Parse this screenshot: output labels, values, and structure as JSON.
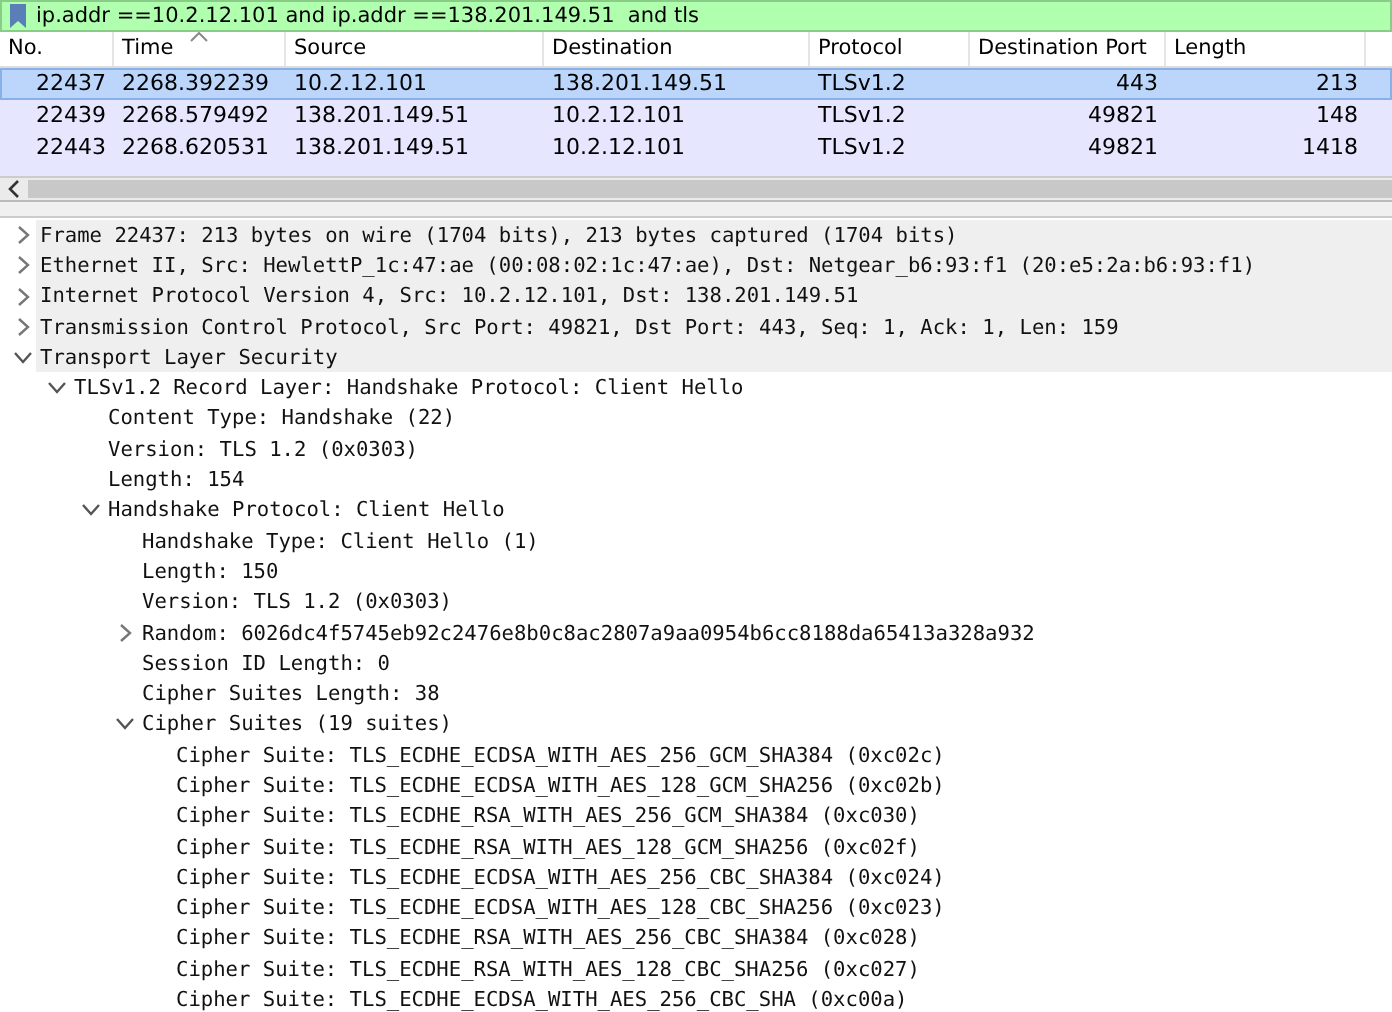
{
  "filter": {
    "value": "ip.addr ==10.2.12.101 and ip.addr ==138.201.149.51  and tls"
  },
  "packet_list": {
    "columns": [
      {
        "label": "No.",
        "sorted": false
      },
      {
        "label": "Time",
        "sorted": true
      },
      {
        "label": "Source",
        "sorted": false
      },
      {
        "label": "Destination",
        "sorted": false
      },
      {
        "label": "Protocol",
        "sorted": false
      },
      {
        "label": "Destination Port",
        "sorted": false
      },
      {
        "label": "Length",
        "sorted": false
      }
    ],
    "rows": [
      {
        "selected": true,
        "cells": [
          "22437",
          "2268.392239",
          "10.2.12.101",
          "138.201.149.51",
          "TLSv1.2",
          "443",
          "213"
        ]
      },
      {
        "selected": false,
        "cells": [
          "22439",
          "2268.579492",
          "138.201.149.51",
          "10.2.12.101",
          "TLSv1.2",
          "49821",
          "148"
        ]
      },
      {
        "selected": false,
        "cells": [
          "22443",
          "2268.620531",
          "138.201.149.51",
          "10.2.12.101",
          "TLSv1.2",
          "49821",
          "1418"
        ]
      }
    ]
  },
  "details": [
    {
      "label": "Frame 22437: 213 bytes on wire (1704 bits), 213 bytes captured (1704 bits)",
      "expanded": false
    },
    {
      "label": "Ethernet II, Src: HewlettP_1c:47:ae (00:08:02:1c:47:ae), Dst: Netgear_b6:93:f1 (20:e5:2a:b6:93:f1)",
      "expanded": false
    },
    {
      "label": "Internet Protocol Version 4, Src: 10.2.12.101, Dst: 138.201.149.51",
      "expanded": false
    },
    {
      "label": "Transmission Control Protocol, Src Port: 49821, Dst Port: 443, Seq: 1, Ack: 1, Len: 159",
      "expanded": false
    },
    {
      "label": "Transport Layer Security",
      "expanded": true,
      "children": [
        {
          "label": "TLSv1.2 Record Layer: Handshake Protocol: Client Hello",
          "expanded": true,
          "children": [
            {
              "label": "Content Type: Handshake (22)"
            },
            {
              "label": "Version: TLS 1.2 (0x0303)"
            },
            {
              "label": "Length: 154"
            },
            {
              "label": "Handshake Protocol: Client Hello",
              "expanded": true,
              "children": [
                {
                  "label": "Handshake Type: Client Hello (1)"
                },
                {
                  "label": "Length: 150"
                },
                {
                  "label": "Version: TLS 1.2 (0x0303)"
                },
                {
                  "label": "Random: 6026dc4f5745eb92c2476e8b0c8ac2807a9aa0954b6cc8188da65413a328a932",
                  "expanded": false
                },
                {
                  "label": "Session ID Length: 0"
                },
                {
                  "label": "Cipher Suites Length: 38"
                },
                {
                  "label": "Cipher Suites (19 suites)",
                  "expanded": true,
                  "children": [
                    {
                      "label": "Cipher Suite: TLS_ECDHE_ECDSA_WITH_AES_256_GCM_SHA384 (0xc02c)"
                    },
                    {
                      "label": "Cipher Suite: TLS_ECDHE_ECDSA_WITH_AES_128_GCM_SHA256 (0xc02b)"
                    },
                    {
                      "label": "Cipher Suite: TLS_ECDHE_RSA_WITH_AES_256_GCM_SHA384 (0xc030)"
                    },
                    {
                      "label": "Cipher Suite: TLS_ECDHE_RSA_WITH_AES_128_GCM_SHA256 (0xc02f)"
                    },
                    {
                      "label": "Cipher Suite: TLS_ECDHE_ECDSA_WITH_AES_256_CBC_SHA384 (0xc024)"
                    },
                    {
                      "label": "Cipher Suite: TLS_ECDHE_ECDSA_WITH_AES_128_CBC_SHA256 (0xc023)"
                    },
                    {
                      "label": "Cipher Suite: TLS_ECDHE_RSA_WITH_AES_256_CBC_SHA384 (0xc028)"
                    },
                    {
                      "label": "Cipher Suite: TLS_ECDHE_RSA_WITH_AES_128_CBC_SHA256 (0xc027)"
                    },
                    {
                      "label": "Cipher Suite: TLS_ECDHE_ECDSA_WITH_AES_256_CBC_SHA (0xc00a)"
                    }
                  ]
                }
              ]
            }
          ]
        }
      ]
    }
  ]
}
